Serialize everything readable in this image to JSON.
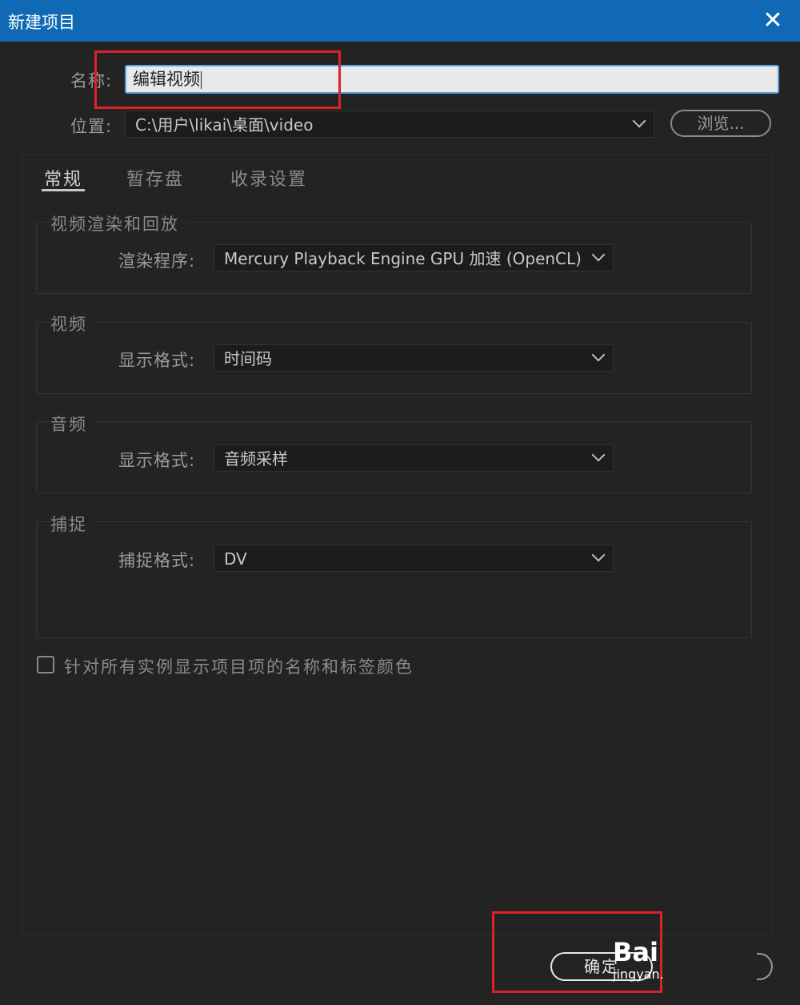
{
  "window": {
    "title": "新建项目",
    "close_glyph": "✕"
  },
  "form": {
    "name_label": "名称:",
    "name_value": "编辑视频",
    "location_label": "位置:",
    "location_value": "C:\\用户\\likai\\桌面\\video",
    "browse_label": "浏览..."
  },
  "tabs": [
    "常规",
    "暂存盘",
    "收录设置"
  ],
  "sections": {
    "render": {
      "title": "视频渲染和回放",
      "field_label": "渲染程序:",
      "value": "Mercury Playback Engine GPU 加速 (OpenCL)"
    },
    "video": {
      "title": "视频",
      "field_label": "显示格式:",
      "value": "时间码"
    },
    "audio": {
      "title": "音频",
      "field_label": "显示格式:",
      "value": "音频采样"
    },
    "capture": {
      "title": "捕捉",
      "field_label": "捕捉格式:",
      "value": "DV"
    }
  },
  "checkbox": {
    "label": "针对所有实例显示项目项的名称和标签颜色",
    "checked": false
  },
  "footer": {
    "ok_label": "确定"
  },
  "watermark": {
    "line1": "Bai",
    "line2": "jingyan."
  },
  "colors": {
    "titlebar": "#0f69b4",
    "background": "#232323",
    "highlight_box": "#d9232a"
  }
}
